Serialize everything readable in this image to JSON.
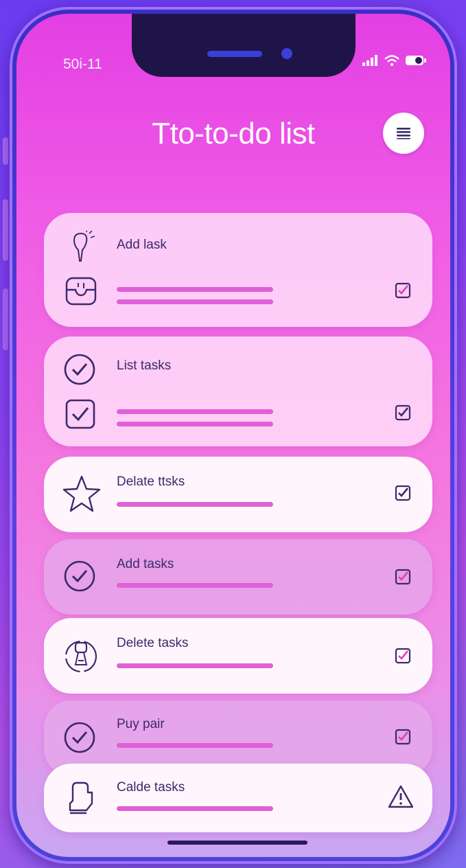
{
  "status_bar": {
    "time": "50i-11",
    "icons": [
      "signal-icon",
      "wifi-icon",
      "battery-icon"
    ]
  },
  "header": {
    "title": "Tto-to-do list",
    "menu_icon": "hamburger-menu-icon"
  },
  "tasks": [
    {
      "label": "Add lask",
      "icon": "lightbulb-icon",
      "secondary_icon": "inbox-icon",
      "checkbox": "checked"
    },
    {
      "label": "List tasks",
      "icon": "check-circle-icon",
      "secondary_icon": "checkbox-icon",
      "checkbox": "checked"
    },
    {
      "label": "Delate ttsks",
      "icon": "star-icon",
      "checkbox": "checked"
    },
    {
      "label": "Add tasks",
      "icon": "check-circle-icon",
      "checkbox": "checked"
    },
    {
      "label": "Delete tasks",
      "icon": "robot-icon",
      "checkbox": "checked"
    },
    {
      "label": "Puy pair",
      "icon": "check-circle-icon",
      "checkbox": "checked"
    },
    {
      "label": "Calde tasks",
      "icon": "document-icon",
      "checkbox": "warning"
    }
  ],
  "colors": {
    "accent": "#e060d8",
    "text": "#3a2a6a",
    "frame": "#3a2fc6"
  }
}
